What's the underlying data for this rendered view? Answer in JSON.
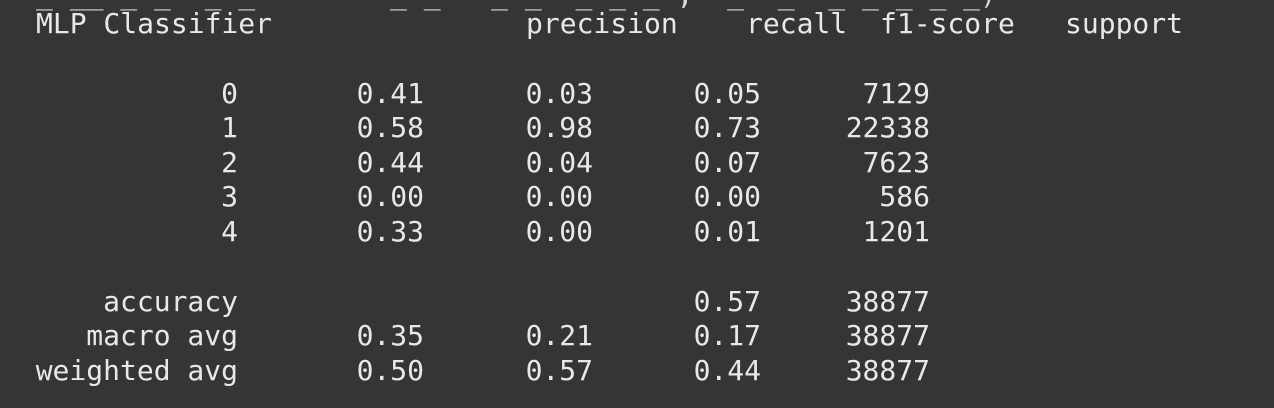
{
  "terminal": {
    "clipped_previous_line": "_ __ _ _  _ _        _ _   _ _  _ _ _ ,  _  _  _ _ _ _ _)",
    "report_title": "MLP Classifier",
    "headers": [
      "precision",
      "recall",
      "f1-score",
      "support"
    ],
    "class_rows": [
      {
        "label": "0",
        "values": [
          "0.41",
          "0.03",
          "0.05",
          "7129"
        ]
      },
      {
        "label": "1",
        "values": [
          "0.58",
          "0.98",
          "0.73",
          "22338"
        ]
      },
      {
        "label": "2",
        "values": [
          "0.44",
          "0.04",
          "0.07",
          "7623"
        ]
      },
      {
        "label": "3",
        "values": [
          "0.00",
          "0.00",
          "0.00",
          "586"
        ]
      },
      {
        "label": "4",
        "values": [
          "0.33",
          "0.00",
          "0.01",
          "1201"
        ]
      }
    ],
    "summary_rows": [
      {
        "label": "accuracy",
        "values": [
          "",
          "",
          "0.57",
          "38877"
        ]
      },
      {
        "label": "macro avg",
        "values": [
          "0.35",
          "0.21",
          "0.17",
          "38877"
        ]
      },
      {
        "label": "weighted avg",
        "values": [
          "0.50",
          "0.57",
          "0.44",
          "38877"
        ]
      }
    ]
  }
}
